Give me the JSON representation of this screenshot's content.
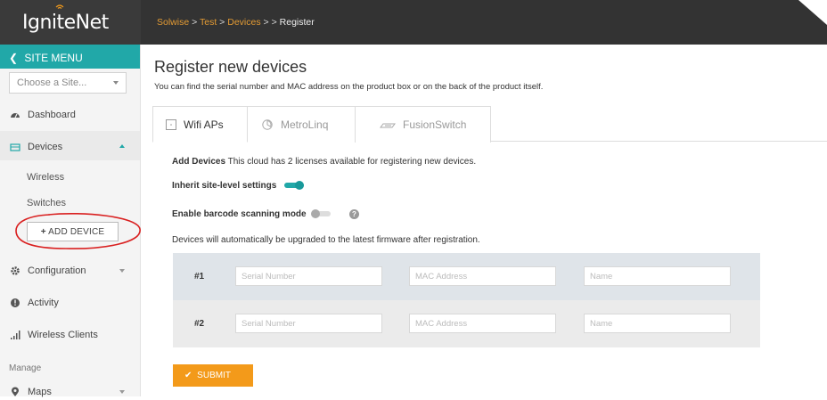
{
  "header": {
    "logo_text": "IgniteNet",
    "breadcrumb": {
      "items": [
        "Solwise",
        "Test",
        "Devices"
      ],
      "separator": ">",
      "current": "Register"
    }
  },
  "sidebar": {
    "menu_title": "SITE MENU",
    "site_select_placeholder": "Choose a Site...",
    "items": {
      "dashboard": "Dashboard",
      "devices": "Devices",
      "wireless": "Wireless",
      "switches": "Switches",
      "add_device": "ADD DEVICE",
      "configuration": "Configuration",
      "activity": "Activity",
      "wireless_clients": "Wireless Clients",
      "manage_section": "Manage",
      "maps": "Maps"
    }
  },
  "main": {
    "title": "Register new devices",
    "subtitle": "You can find the serial number and MAC address on the product box or on the back of the product itself.",
    "tabs": [
      {
        "label": "Wifi APs",
        "active": true
      },
      {
        "label": "MetroLinq",
        "active": false
      },
      {
        "label": "FusionSwitch",
        "active": false
      }
    ],
    "add_devices_heading": "Add Devices",
    "license_text": "This cloud has 2 licenses available for registering new devices.",
    "inherit_label": "Inherit site-level settings",
    "inherit_on": true,
    "barcode_label": "Enable barcode scanning mode",
    "barcode_on": false,
    "firmware_note": "Devices will automatically be upgraded to the latest firmware after registration.",
    "rows": [
      {
        "num": "#1",
        "serial_placeholder": "Serial Number",
        "mac_placeholder": "MAC Address",
        "name_placeholder": "Name"
      },
      {
        "num": "#2",
        "serial_placeholder": "Serial Number",
        "mac_placeholder": "MAC Address",
        "name_placeholder": "Name"
      }
    ],
    "submit_label": "SUBMIT"
  },
  "colors": {
    "topbar": "#333333",
    "accent_teal": "#21a8a8",
    "accent_orange": "#f39a1a",
    "breadcrumb_link": "#e39b34",
    "row_dark": "#dfe4e9",
    "row_light": "#ebebeb",
    "annotation_red": "#d92020"
  },
  "icons": [
    "wifi-logo-icon",
    "chevron-left-icon",
    "dashboard-icon",
    "devices-icon",
    "gear-icon",
    "activity-icon",
    "signal-bars-icon",
    "map-pin-icon",
    "plus-icon",
    "checkmark-icon",
    "question-icon",
    "wifi-ap-icon",
    "metrolinq-icon",
    "fusionswitch-icon"
  ]
}
